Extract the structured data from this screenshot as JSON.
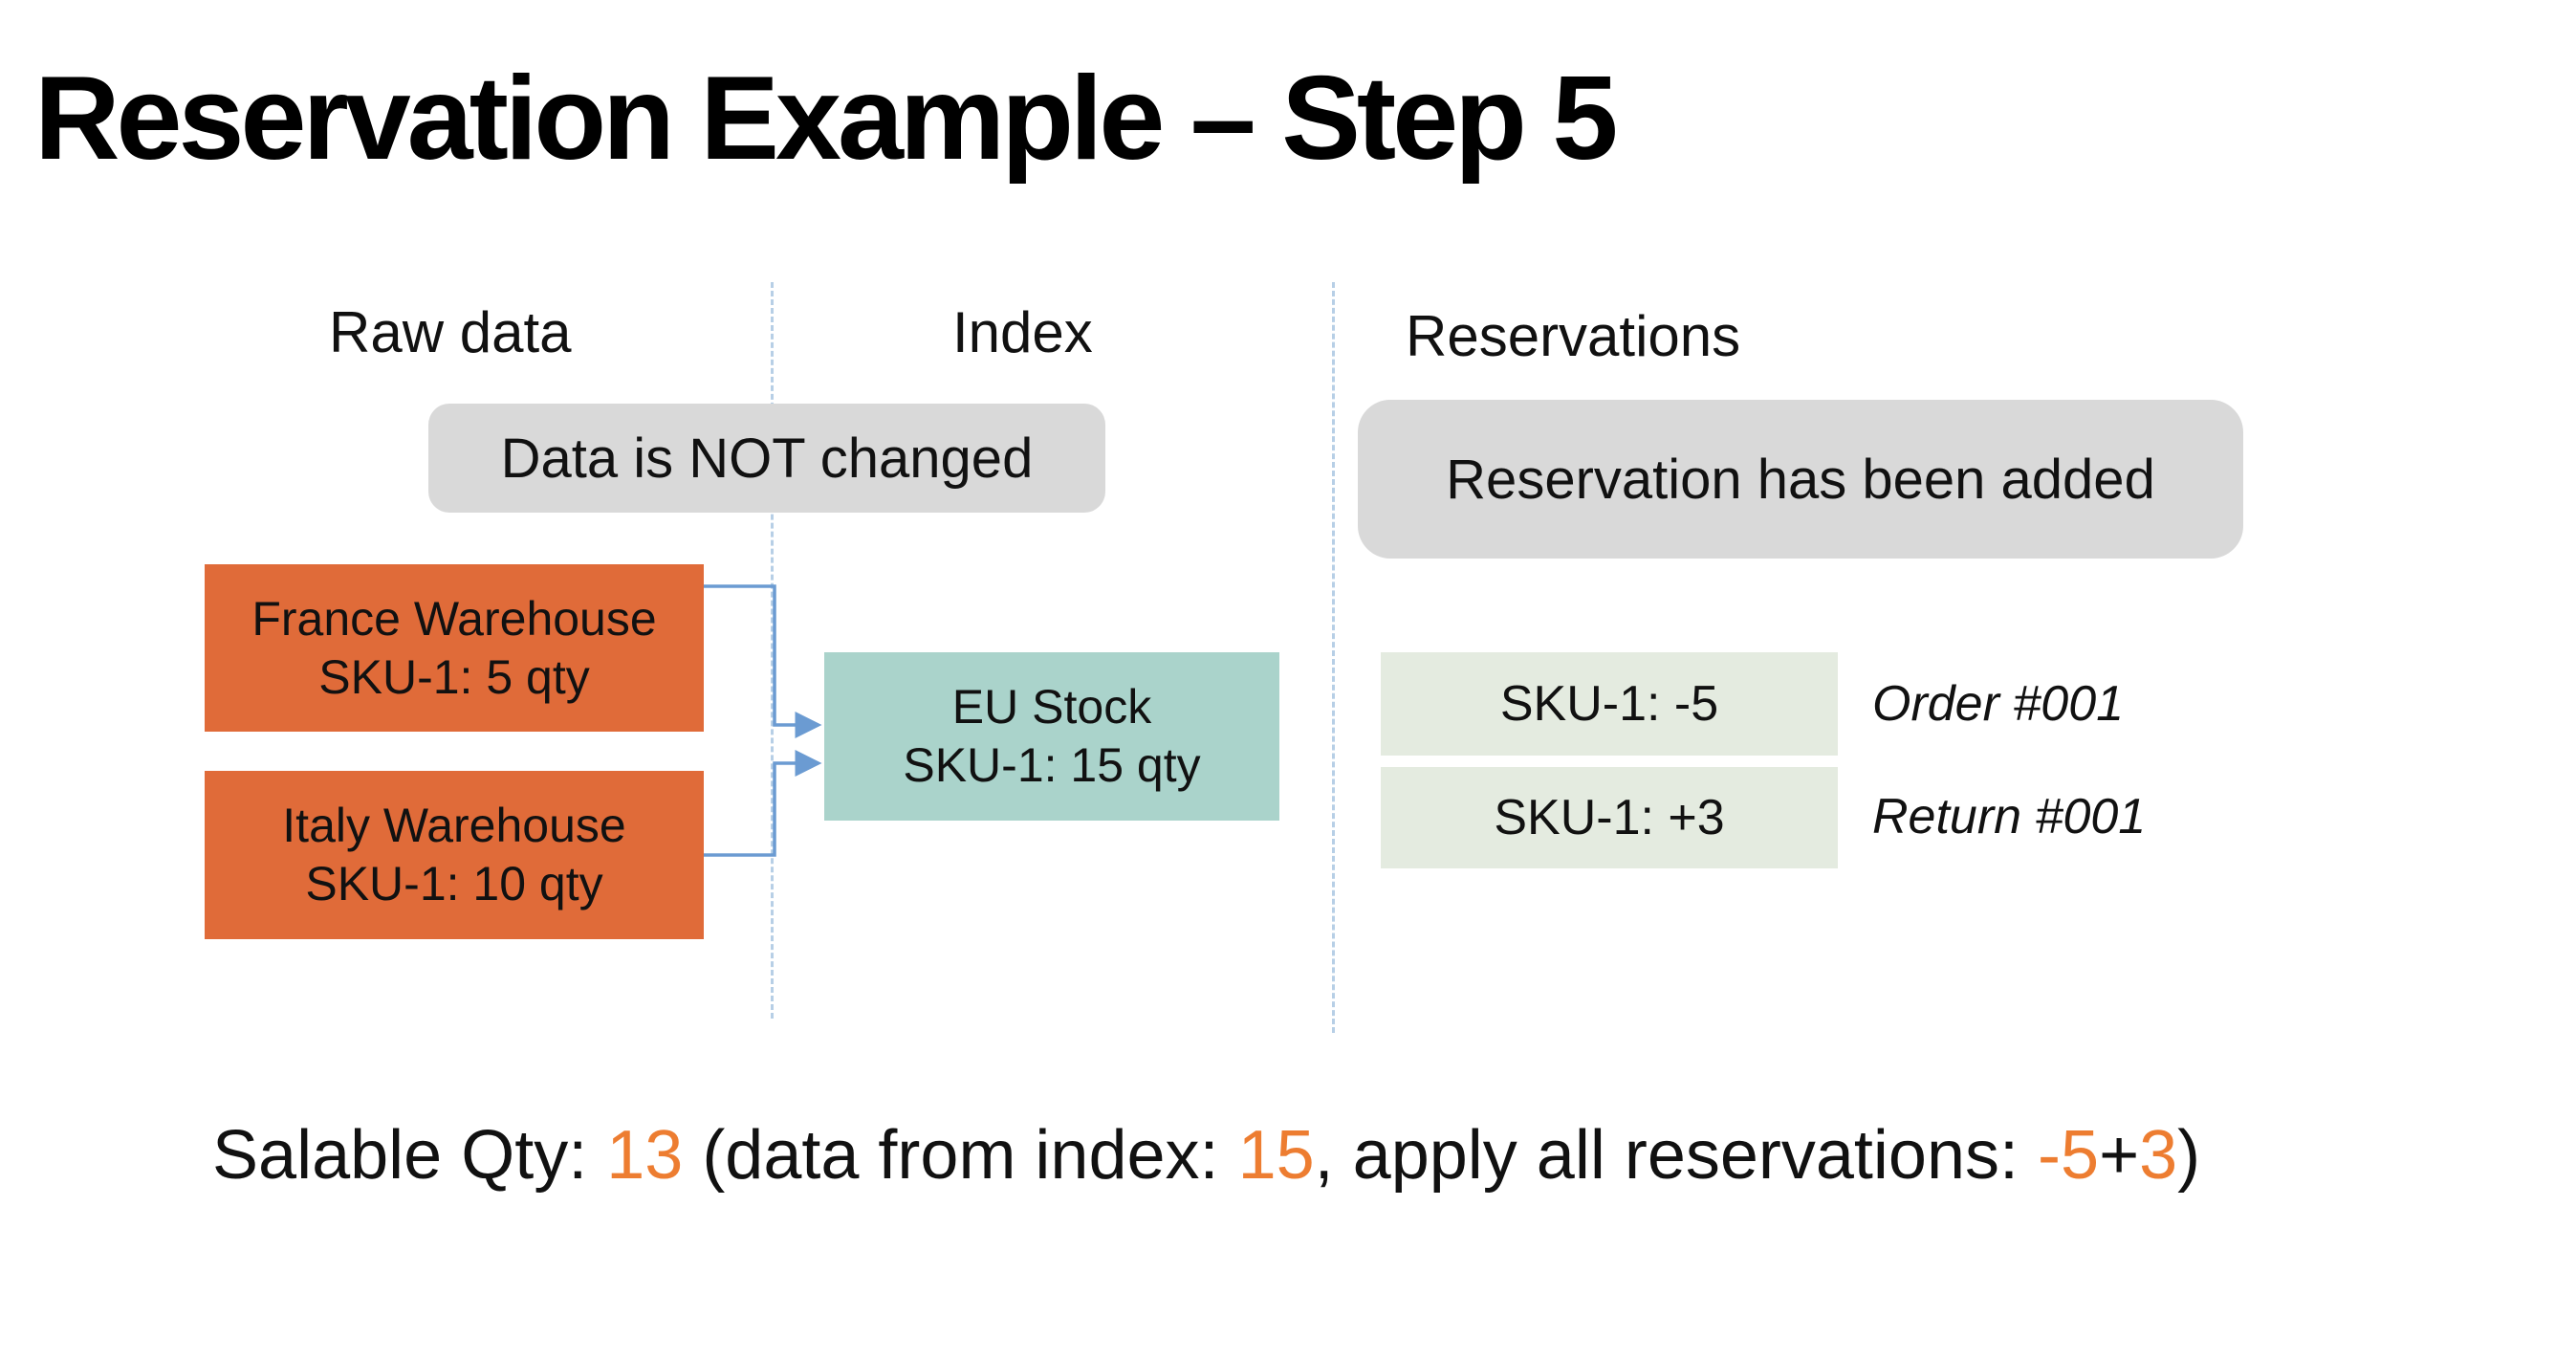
{
  "title": "Reservation Example – Step 5",
  "columns": {
    "raw_data": "Raw data",
    "index": "Index",
    "reservations": "Reservations"
  },
  "callouts": {
    "raw_index_note": "Data is NOT changed",
    "reservations_note": "Reservation has been added"
  },
  "warehouses": [
    {
      "name": "France Warehouse",
      "stock": "SKU-1: 5 qty"
    },
    {
      "name": "Italy Warehouse",
      "stock": "SKU-1: 10 qty"
    }
  ],
  "index_box": {
    "name": "EU Stock",
    "stock": "SKU-1: 15 qty"
  },
  "reservation_rows": [
    {
      "value": "SKU-1: -5",
      "label": "Order #001"
    },
    {
      "value": "SKU-1: +3",
      "label": "Return #001"
    }
  ],
  "summary": {
    "prefix": "Salable Qty: ",
    "salable_qty": "13",
    "mid1": " (data from index: ",
    "index_qty": "15",
    "mid2": ", apply all reservations: ",
    "res1": "-5",
    "plus": "+",
    "res2": "3",
    "suffix": ")"
  },
  "colors": {
    "warehouse": "#e06b39",
    "index": "#aad3cb",
    "reservation": "#e4ebe0",
    "callout": "#d9d9d9",
    "highlight": "#ed7d31",
    "connector": "#6b9bd2",
    "divider": "#b7cfe6"
  }
}
